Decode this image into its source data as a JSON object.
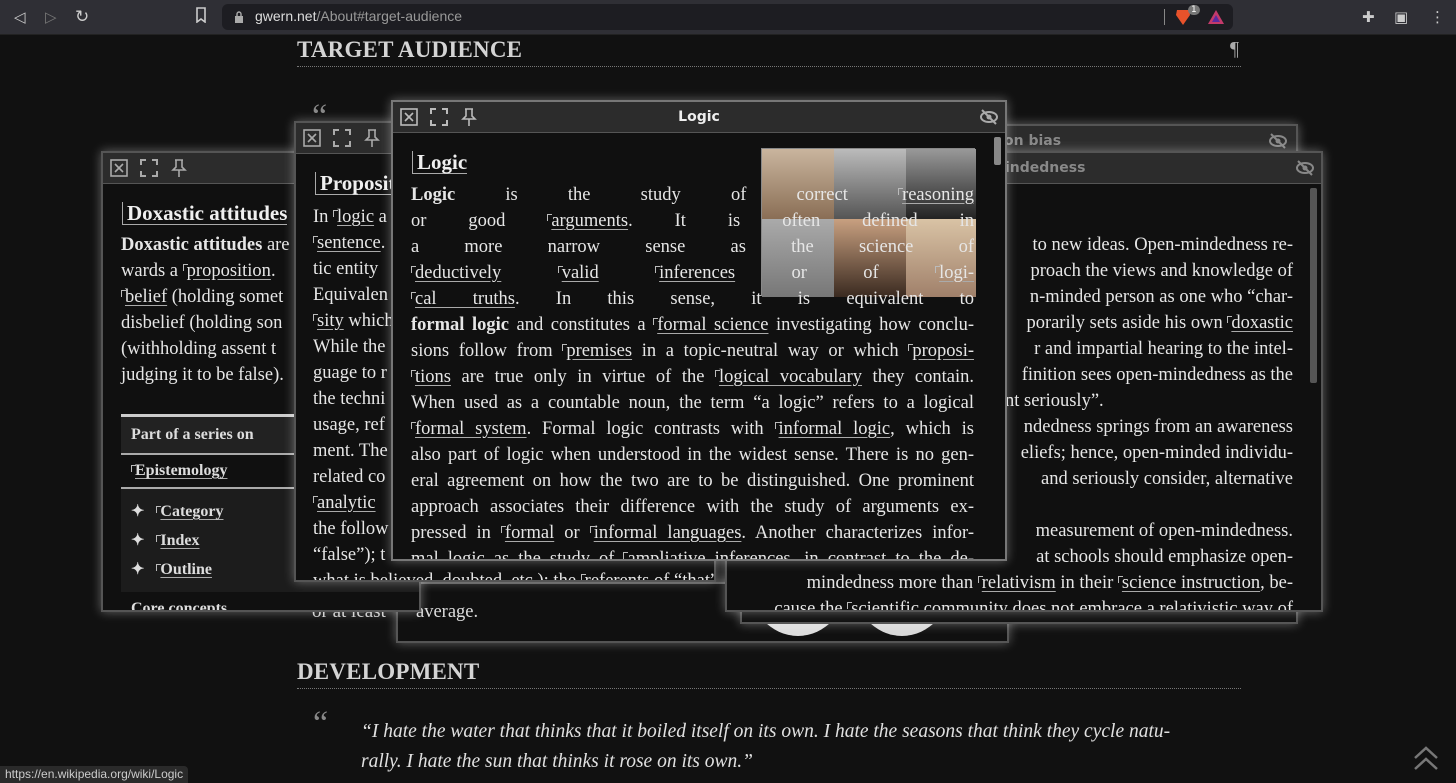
{
  "browser": {
    "url_domain": "gwern.net",
    "url_path": "/About#target-audience",
    "shields_badge": "1",
    "status_url": "https://en.wikipedia.org/wiki/Logic"
  },
  "page": {
    "section1_title": "TARGET AUDIENCE",
    "pilcrow": "¶",
    "open_quote": "“",
    "visible_fragment": "or at least",
    "section2_title": "DEVELOPMENT",
    "quote_mark": "“",
    "quote_lines": [
      "“I hate the water that thinks that it boiled itself on its own. I hate the seasons that think they cycle natu-",
      "rally. I hate the sun that thinks it rose on its own.”"
    ]
  },
  "popups": {
    "logic": {
      "title": "Logic",
      "heading": "Logic",
      "lines": [
        [
          {
            "t": "Logic",
            "k": "b"
          },
          {
            "t": " is the study of correct "
          },
          {
            "t": "reasoning",
            "k": "l"
          }
        ],
        [
          {
            "t": "or good "
          },
          {
            "t": "arguments",
            "k": "l"
          },
          {
            "t": ". It is often defined in"
          }
        ],
        [
          {
            "t": "a more narrow sense as the science of"
          }
        ],
        [
          {
            "t": "deductively",
            "k": "l"
          },
          {
            "t": " "
          },
          {
            "t": "valid",
            "k": "l"
          },
          {
            "t": " "
          },
          {
            "t": "inferences",
            "k": "l"
          },
          {
            "t": " or of "
          },
          {
            "t": "logi-",
            "k": "l"
          }
        ],
        [
          {
            "t": "cal truths",
            "k": "l"
          },
          {
            "t": ". In this sense, it is equivalent to"
          }
        ],
        [
          {
            "t": "formal logic",
            "k": "b"
          },
          {
            "t": " and constitutes a "
          },
          {
            "t": "formal science",
            "k": "l"
          },
          {
            "t": " investigating how conclu-"
          }
        ],
        [
          {
            "t": "sions follow from "
          },
          {
            "t": "premises",
            "k": "l"
          },
          {
            "t": " in a topic-neutral way or which "
          },
          {
            "t": "proposi-",
            "k": "l"
          }
        ],
        [
          {
            "t": "tions",
            "k": "l"
          },
          {
            "t": " are true only in virtue of the "
          },
          {
            "t": "logical vocabulary",
            "k": "l"
          },
          {
            "t": " they contain."
          }
        ],
        [
          {
            "t": "When used as a countable noun, the term “a logic” refers to a logical"
          }
        ],
        [
          {
            "t": "formal system",
            "k": "l"
          },
          {
            "t": ". Formal logic contrasts with "
          },
          {
            "t": "informal logic",
            "k": "l"
          },
          {
            "t": ", which is"
          }
        ],
        [
          {
            "t": "also part of logic when understood in the widest sense. There is no gen-"
          }
        ],
        [
          {
            "t": "eral agreement on how the two are to be distinguished. One prominent"
          }
        ],
        [
          {
            "t": "approach associates their difference with the study of arguments ex-"
          }
        ],
        [
          {
            "t": "pressed in "
          },
          {
            "t": "formal",
            "k": "l"
          },
          {
            "t": " or "
          },
          {
            "t": "informal languages",
            "k": "l"
          },
          {
            "t": ". Another characterizes infor-"
          }
        ],
        [
          {
            "t": "mal logic as the study of "
          },
          {
            "t": "ampliative inferences",
            "k": "l"
          },
          {
            "t": ", in contrast to the de-"
          }
        ]
      ]
    },
    "proposition": {
      "heading": "Proposition",
      "lines": [
        [
          {
            "t": "In "
          },
          {
            "t": "logic",
            "k": "l"
          },
          {
            "t": " a"
          }
        ],
        [
          {
            "t": "sentence",
            "k": "l"
          },
          {
            "t": "."
          }
        ],
        [
          {
            "t": "tic entity"
          }
        ],
        [
          {
            "t": "Equivalen"
          }
        ],
        [
          {
            "t": "sity",
            "k": "l"
          },
          {
            "t": " which"
          }
        ],
        [
          {
            "t": "While the"
          }
        ],
        [
          {
            "t": "guage to r"
          }
        ],
        [
          {
            "t": "the techni"
          }
        ],
        [
          {
            "t": "usage, ref"
          }
        ],
        [
          {
            "t": "ment. The"
          }
        ],
        [
          {
            "t": "related co"
          }
        ],
        [
          {
            "t": "analytic",
            "k": "l"
          }
        ],
        [
          {
            "t": "the follow"
          }
        ],
        [
          {
            "t": "“false”); t"
          }
        ],
        [
          {
            "t": "what is believed, doubted, etc.); the "
          },
          {
            "t": "referents of “that” clauses",
            "k": "l"
          },
          {
            "t": " (e.g. “It"
          }
        ]
      ]
    },
    "doxastic": {
      "heading": "Doxastic attitudes",
      "lines": [
        [
          {
            "t": "Doxastic attitudes",
            "k": "b"
          },
          {
            "t": " are"
          }
        ],
        [
          {
            "t": "wards a "
          },
          {
            "t": "proposition",
            "k": "l"
          },
          {
            "t": "."
          }
        ],
        [
          {
            "t": "belief",
            "k": "l"
          },
          {
            "t": " (holding somet"
          }
        ],
        [
          {
            "t": "disbelief (holding son"
          }
        ],
        [
          {
            "t": "(withholding assent t"
          }
        ],
        [
          {
            "t": "judging it to be false)."
          }
        ]
      ],
      "infobox": {
        "header": "Part of a series on",
        "topic": "Epistemology",
        "items": [
          "Category",
          "Index",
          "Outline"
        ],
        "bullet": "✦",
        "section": "Core concepts"
      }
    },
    "bias": {
      "title_fragment": "on bias"
    },
    "openmindedness": {
      "title_fragment": "indedness",
      "lines": [
        [
          {
            "t": "to new ideas. Open-mindedness re-"
          }
        ],
        [
          {
            "t": "proach the views and knowledge of"
          }
        ],
        [
          {
            "t": "n-minded person as one who “char-"
          }
        ],
        [
          {
            "t": "porarily sets aside his own "
          },
          {
            "t": "doxastic",
            "k": "l"
          }
        ],
        [
          {
            "t": "r and impartial hearing to the intel-"
          }
        ],
        [
          {
            "t": "finition sees open-mindedness as the"
          }
        ],
        [
          {
            "t": "nt seriously”."
          }
        ],
        [
          {
            "t": "ndedness springs from an awareness"
          }
        ],
        [
          {
            "t": "eliefs; hence, open-minded individu-"
          }
        ],
        [
          {
            "t": "and seriously consider, alternative"
          }
        ],
        [
          {
            "t": " "
          }
        ],
        [
          {
            "t": "measurement of open-mindedness."
          }
        ],
        [
          {
            "t": "at schools should emphasize open-"
          }
        ],
        [
          {
            "t": "mindedness more than "
          },
          {
            "t": "relativism",
            "k": "l"
          },
          {
            "t": " in their "
          },
          {
            "t": "science instruction",
            "k": "l"
          },
          {
            "t": ", be-"
          }
        ],
        [
          {
            "t": "cause the "
          },
          {
            "t": "scientific community",
            "k": "l"
          },
          {
            "t": " does not embrace a relativistic way of"
          }
        ]
      ]
    },
    "average": {
      "text": "average."
    }
  }
}
